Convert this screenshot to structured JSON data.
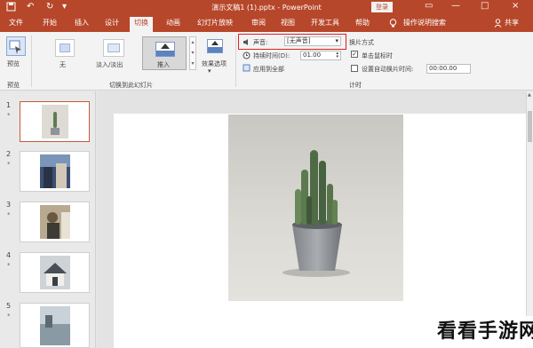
{
  "window": {
    "title": "演示文稿1 (1).pptx - PowerPoint",
    "login_label": "登录",
    "minimize": "—",
    "restore": "□",
    "close": "×"
  },
  "tabs": [
    "文件",
    "开始",
    "插入",
    "设计",
    "切换",
    "动画",
    "幻灯片放映",
    "审阅",
    "视图",
    "开发工具",
    "帮助"
  ],
  "tell_me": "操作说明搜索",
  "share": "共享",
  "ribbon": {
    "preview_label": "预览",
    "preview_group": "预览",
    "transitions": [
      "无",
      "淡入/淡出",
      "推入"
    ],
    "effect_options": "效果选项",
    "transition_group": "切换到此幻灯片",
    "sound_label": "声音:",
    "sound_value": "[无声音]",
    "duration_label": "持续时间(D):",
    "duration_value": "01.00",
    "apply_all": "应用到全部",
    "advance_label": "换片方式",
    "on_click": "单击鼠标时",
    "after_time": "设置自动换片时间:",
    "after_value": "00:00.00",
    "timing_group": "计时"
  },
  "slides": [
    {
      "num": "1",
      "star": "*"
    },
    {
      "num": "2",
      "star": "*"
    },
    {
      "num": "3",
      "star": "*"
    },
    {
      "num": "4",
      "star": "*"
    },
    {
      "num": "5",
      "star": "*"
    }
  ],
  "watermark": "看看手游网",
  "colors": {
    "accent": "#b7472a",
    "highlight": "#e02020"
  },
  "icons": [
    "save-icon",
    "undo-icon",
    "redo-icon",
    "lightbulb-icon",
    "person-icon",
    "speaker-icon",
    "clock-icon"
  ]
}
